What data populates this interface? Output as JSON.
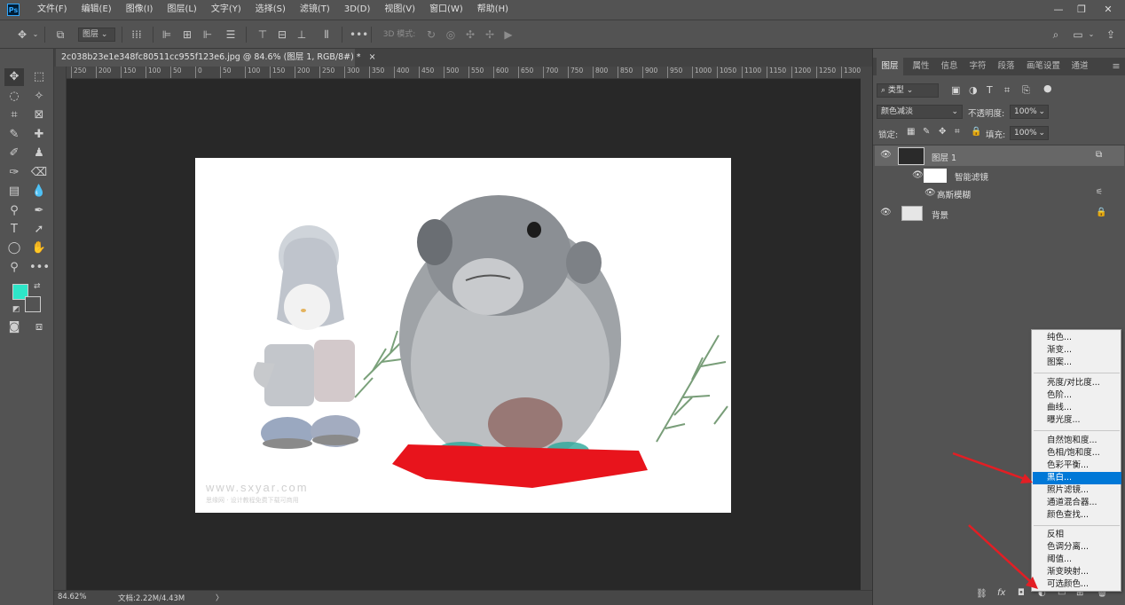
{
  "app": {
    "logo": "Ps"
  },
  "menubar": {
    "items": [
      "文件(F)",
      "编辑(E)",
      "图像(I)",
      "图层(L)",
      "文字(Y)",
      "选择(S)",
      "滤镜(T)",
      "3D(D)",
      "视图(V)",
      "窗口(W)",
      "帮助(H)"
    ]
  },
  "options_bar": {
    "select_value": "图层",
    "mode_3d_label": "3D 模式:"
  },
  "document": {
    "tab_title": "2c038b23e1e348fc80511cc955f123e6.jpg @ 84.6% (图层 1, RGB/8#) *",
    "tab_close": "×",
    "watermark_url": "www.sxyar.com",
    "watermark_sub": "思缘网 · 设计教程免费下载可商用",
    "ruler_labels": [
      "250",
      "200",
      "150",
      "100",
      "50",
      "0",
      "50",
      "100",
      "150",
      "200",
      "250",
      "300",
      "350",
      "400",
      "450",
      "500",
      "550",
      "600",
      "650",
      "700",
      "750",
      "800",
      "850",
      "900",
      "950",
      "1000",
      "1050",
      "1100",
      "1150",
      "1200",
      "1250",
      "1300"
    ]
  },
  "colors": {
    "foreground": "#2ee6c8",
    "background": "#535353",
    "accent": "#0078d7"
  },
  "status_bar": {
    "zoom": "84.62%",
    "doc_info": "文档:2.22M/4.43M",
    "arrow": "〉"
  },
  "layers_panel": {
    "tabs": [
      "图层",
      "属性",
      "信息",
      "字符",
      "段落",
      "画笔设置",
      "通道"
    ],
    "filter_kind": "类型",
    "blend_mode": "颜色减淡",
    "opacity_label": "不透明度:",
    "opacity_value": "100%",
    "lock_label": "锁定:",
    "fill_label": "填充:",
    "fill_value": "100%",
    "layers": [
      {
        "name": "图层 1",
        "visible": true
      },
      {
        "name": "智能滤镜",
        "visible": true
      },
      {
        "name": "高斯模糊",
        "visible": true
      },
      {
        "name": "背景",
        "visible": true
      }
    ],
    "bottom_icons": [
      "link-icon",
      "fx-icon",
      "mask-icon",
      "adjustment-icon",
      "group-icon",
      "new-layer-icon",
      "trash-icon"
    ],
    "bottom_fx": "fx"
  },
  "adjustment_menu": {
    "groups": [
      [
        "纯色...",
        "渐变...",
        "图案..."
      ],
      [
        "亮度/对比度...",
        "色阶...",
        "曲线...",
        "曝光度..."
      ],
      [
        "自然饱和度...",
        "色相/饱和度...",
        "色彩平衡...",
        "黑白...",
        "照片滤镜...",
        "通道混合器...",
        "颜色查找..."
      ],
      [
        "反相",
        "色调分离...",
        "阈值...",
        "渐变映射...",
        "可选颜色..."
      ]
    ],
    "selected": "黑白..."
  }
}
